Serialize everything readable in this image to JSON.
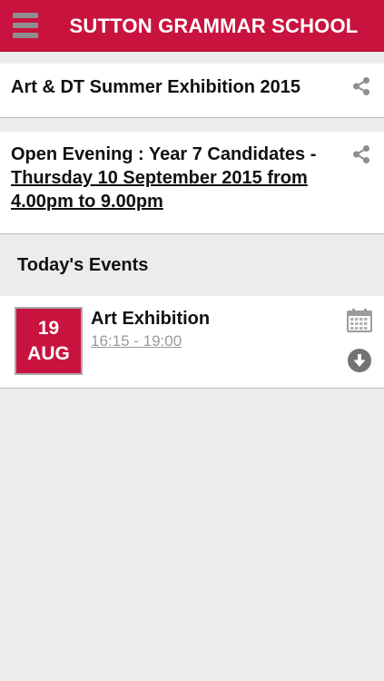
{
  "header": {
    "title": "SUTTON GRAMMAR SCHOOL",
    "menu_icon": "hamburger-menu-icon",
    "background_color": "#c8133e"
  },
  "news": [
    {
      "title": "Art & DT Summer Exhibition 2015",
      "share_icon": "share-icon"
    },
    {
      "title_plain": "Open Evening : Year 7 Candidates  - ",
      "title_link": "Thursday 10 September 2015 from 4.00pm to 9.00pm",
      "share_icon": "share-icon"
    }
  ],
  "events_section": {
    "heading": "Today's Events",
    "events": [
      {
        "day": "19",
        "month": "AUG",
        "title": "Art Exhibition",
        "time": "16:15 - 19:00",
        "calendar_icon": "calendar-icon",
        "download_icon": "download-icon"
      }
    ]
  },
  "colors": {
    "accent": "#c8133e",
    "background": "#ececec",
    "icon_gray": "#8e8e8e",
    "muted_text": "#9a9a9a"
  }
}
